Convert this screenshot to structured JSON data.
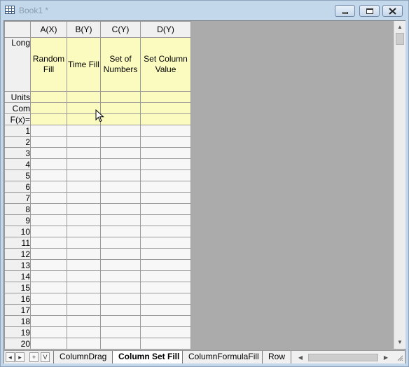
{
  "window": {
    "title": "Book1 *",
    "controls": {
      "minimize": "minimize",
      "restore": "restore",
      "close": "close"
    }
  },
  "columns": [
    {
      "header": "A(X)",
      "long_name": "Random Fill"
    },
    {
      "header": "B(Y)",
      "long_name": "Time Fill"
    },
    {
      "header": "C(Y)",
      "long_name": "Set of Numbers"
    },
    {
      "header": "D(Y)",
      "long_name": "Set Column Value"
    }
  ],
  "meta_rows": {
    "long": "Long",
    "units": "Units",
    "comments": "Com",
    "formula": "F(x)="
  },
  "rows": [
    "1",
    "2",
    "3",
    "4",
    "5",
    "6",
    "7",
    "8",
    "9",
    "10",
    "11",
    "12",
    "13",
    "14",
    "15",
    "16",
    "17",
    "18",
    "19",
    "20"
  ],
  "tabbar": {
    "nav": {
      "prev": "◂",
      "next": "▸",
      "add": "+",
      "menu": "V"
    },
    "tabs": [
      {
        "label": "ColumnDrag",
        "active": false
      },
      {
        "label": "Column Set Fill",
        "active": true
      },
      {
        "label": "ColumnFormulaFill",
        "active": false
      },
      {
        "label": "Row",
        "active": false
      }
    ]
  },
  "colors": {
    "meta_bg": "#fbfbc0",
    "header_bg": "#f0f0f0",
    "title_bar": "#c4d8ec"
  }
}
